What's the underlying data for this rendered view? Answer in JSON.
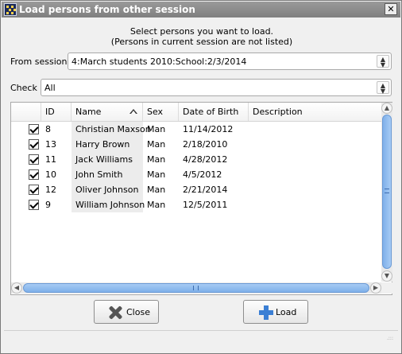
{
  "window": {
    "title": "Load persons from other session",
    "close_glyph": "✕"
  },
  "intro": {
    "line1": "Select persons you want to load.",
    "line2": "(Persons in current session are not listed)"
  },
  "from_session": {
    "label": "From session",
    "value": "4:March students 2010:School:2/3/2014"
  },
  "check": {
    "label": "Check",
    "value": "All"
  },
  "table": {
    "columns": [
      "ID",
      "Name",
      "Sex",
      "Date of Birth",
      "Description"
    ],
    "sort_column": "Name",
    "rows": [
      {
        "checked": true,
        "id": "8",
        "name": "Christian Maxson",
        "sex": "Man",
        "dob": "11/14/2012",
        "description": ""
      },
      {
        "checked": true,
        "id": "13",
        "name": "Harry Brown",
        "sex": "Man",
        "dob": "2/18/2010",
        "description": ""
      },
      {
        "checked": true,
        "id": "11",
        "name": "Jack Williams",
        "sex": "Man",
        "dob": "4/28/2012",
        "description": ""
      },
      {
        "checked": true,
        "id": "10",
        "name": "John Smith",
        "sex": "Man",
        "dob": "4/5/2012",
        "description": ""
      },
      {
        "checked": true,
        "id": "12",
        "name": "Oliver Johnson",
        "sex": "Man",
        "dob": "2/21/2014",
        "description": ""
      },
      {
        "checked": true,
        "id": "9",
        "name": "William Johnson",
        "sex": "Man",
        "dob": "12/5/2011",
        "description": ""
      }
    ]
  },
  "buttons": {
    "close_label": "Close",
    "load_label": "Load"
  },
  "icons": {
    "app": "app-icon",
    "close": "close-icon",
    "load": "plus-icon",
    "sort": "sort-ascending-icon"
  },
  "colors": {
    "titlebar": "#8c8c8c",
    "scroll_accent": "#7fb0ea",
    "load_plus": "#3b7fd4"
  }
}
